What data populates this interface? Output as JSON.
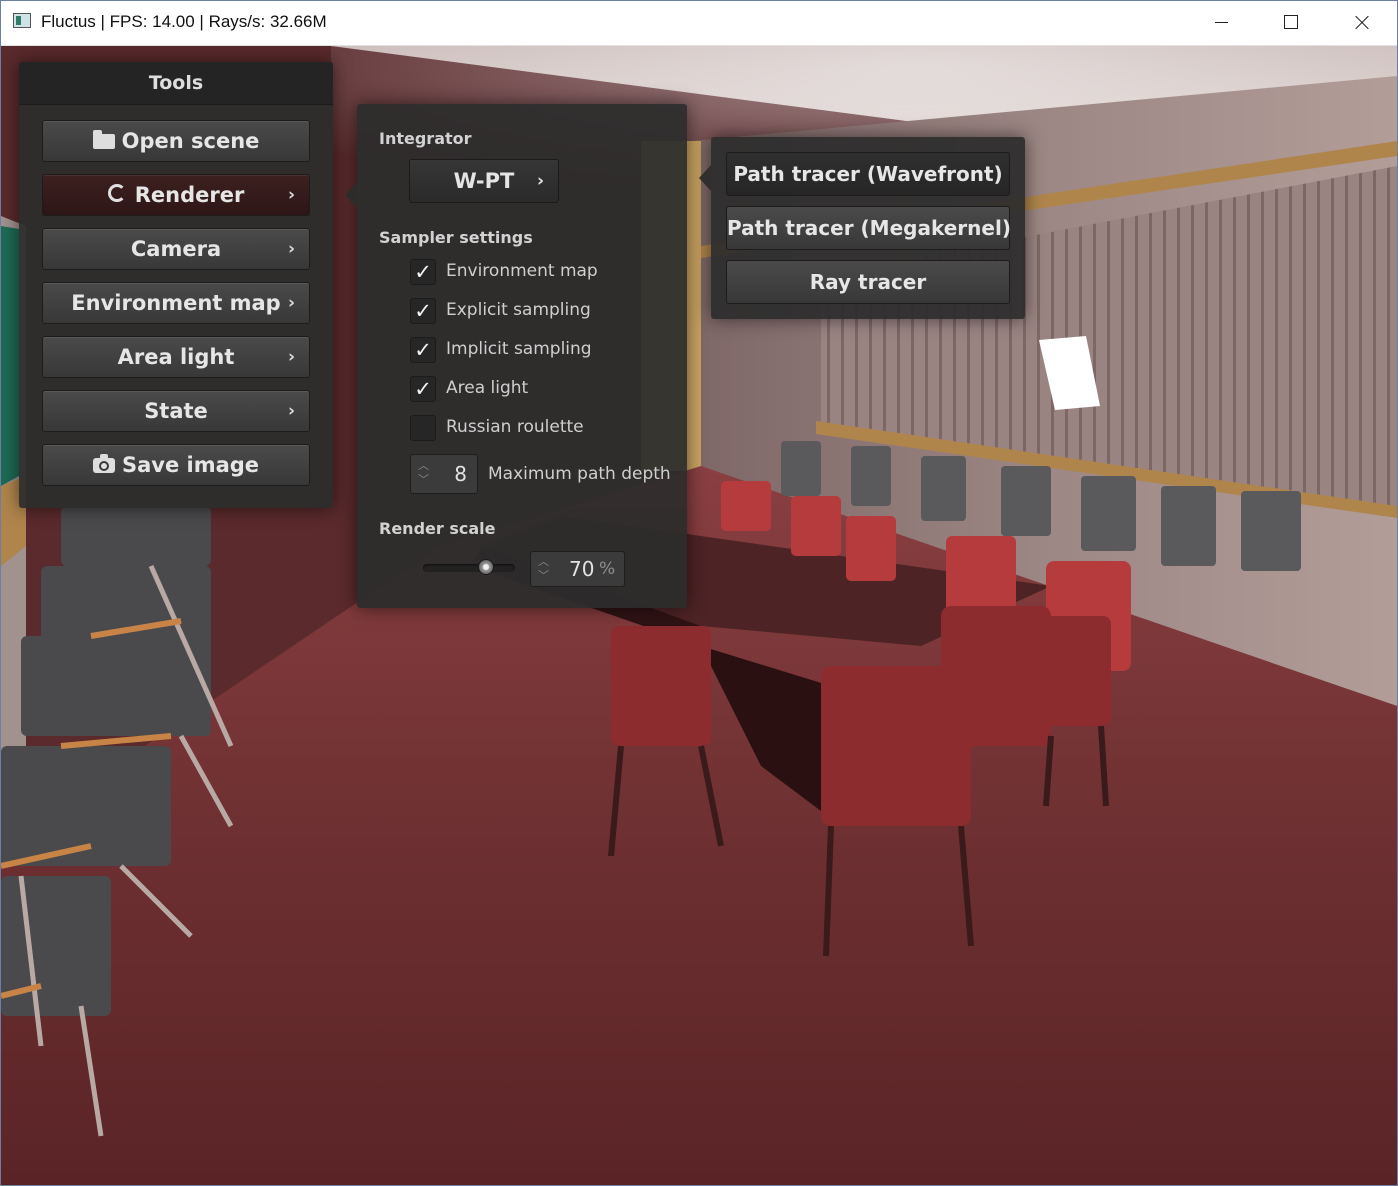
{
  "window": {
    "title": "Fluctus | FPS: 14.00 | Rays/s: 32.66M"
  },
  "icons": {
    "app": "fluctus-app-icon",
    "minimize": "minimize-icon",
    "maximize": "maximize-icon",
    "close": "close-icon",
    "open_scene": "folder-icon",
    "renderer": "refresh-icon",
    "save_image": "camera-icon",
    "submenu": "chevron-right-icon"
  },
  "tools": {
    "title": "Tools",
    "buttons": [
      {
        "label": "Open scene",
        "has_submenu": false
      },
      {
        "label": "Renderer",
        "has_submenu": true,
        "active": true
      },
      {
        "label": "Camera",
        "has_submenu": true
      },
      {
        "label": "Environment map",
        "has_submenu": true
      },
      {
        "label": "Area light",
        "has_submenu": true
      },
      {
        "label": "State",
        "has_submenu": true
      },
      {
        "label": "Save image",
        "has_submenu": false
      }
    ],
    "chevron": "›"
  },
  "renderer": {
    "integrator_label": "Integrator",
    "integrator_value": "W-PT",
    "sampler_label": "Sampler settings",
    "options": [
      {
        "label": "Environment map",
        "checked": true
      },
      {
        "label": "Explicit sampling",
        "checked": true
      },
      {
        "label": "Implicit sampling",
        "checked": true
      },
      {
        "label": "Area light",
        "checked": true
      },
      {
        "label": "Russian roulette",
        "checked": false
      }
    ],
    "check_mark": "✓",
    "max_depth_value": "8",
    "max_depth_label": "Maximum path depth",
    "render_scale_label": "Render scale",
    "render_scale_value": "70",
    "render_scale_unit": "%",
    "render_scale_fraction": 0.7
  },
  "integrator_menu": {
    "items": [
      {
        "label": "Path tracer (Wavefront)",
        "selected": true
      },
      {
        "label": "Path tracer (Megakernel)",
        "selected": false
      },
      {
        "label": "Ray tracer",
        "selected": false
      }
    ]
  },
  "colors": {
    "panel_bg": "#2c2c2c",
    "button_bg": "#424242",
    "active_button_bg": "#361b1b",
    "text": "#e6e6e6",
    "floor": "#6e3032",
    "wall": "#a89a96"
  }
}
